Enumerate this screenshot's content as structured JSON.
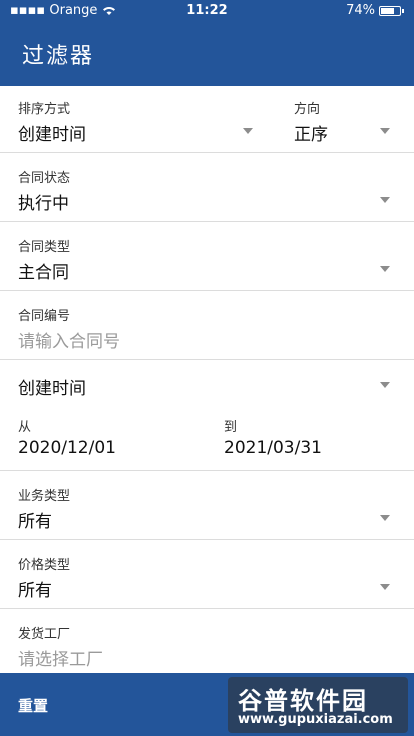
{
  "status": {
    "carrier": "Orange",
    "time": "11:22",
    "battery": "74%",
    "battery_level": 0.74
  },
  "header": {
    "title": "过滤器"
  },
  "sort": {
    "label": "排序方式",
    "value": "创建时间",
    "dir_label": "方向",
    "dir_value": "正序"
  },
  "contract_status": {
    "label": "合同状态",
    "value": "执行中"
  },
  "contract_type": {
    "label": "合同类型",
    "value": "主合同"
  },
  "contract_no": {
    "label": "合同编号",
    "placeholder": "请输入合同号"
  },
  "date_field": {
    "value": "创建时间"
  },
  "date_range": {
    "from_label": "从",
    "from_value": "2020/12/01",
    "to_label": "到",
    "to_value": "2021/03/31"
  },
  "business_type": {
    "label": "业务类型",
    "value": "所有"
  },
  "price_type": {
    "label": "价格类型",
    "value": "所有"
  },
  "factory": {
    "label": "发货工厂",
    "placeholder": "请选择工厂"
  },
  "footer": {
    "reset_label": "重置"
  },
  "watermark": {
    "line1": "谷普软件园",
    "line2": "www.gupuxiazai.com"
  },
  "colors": {
    "primary": "#23559a"
  }
}
